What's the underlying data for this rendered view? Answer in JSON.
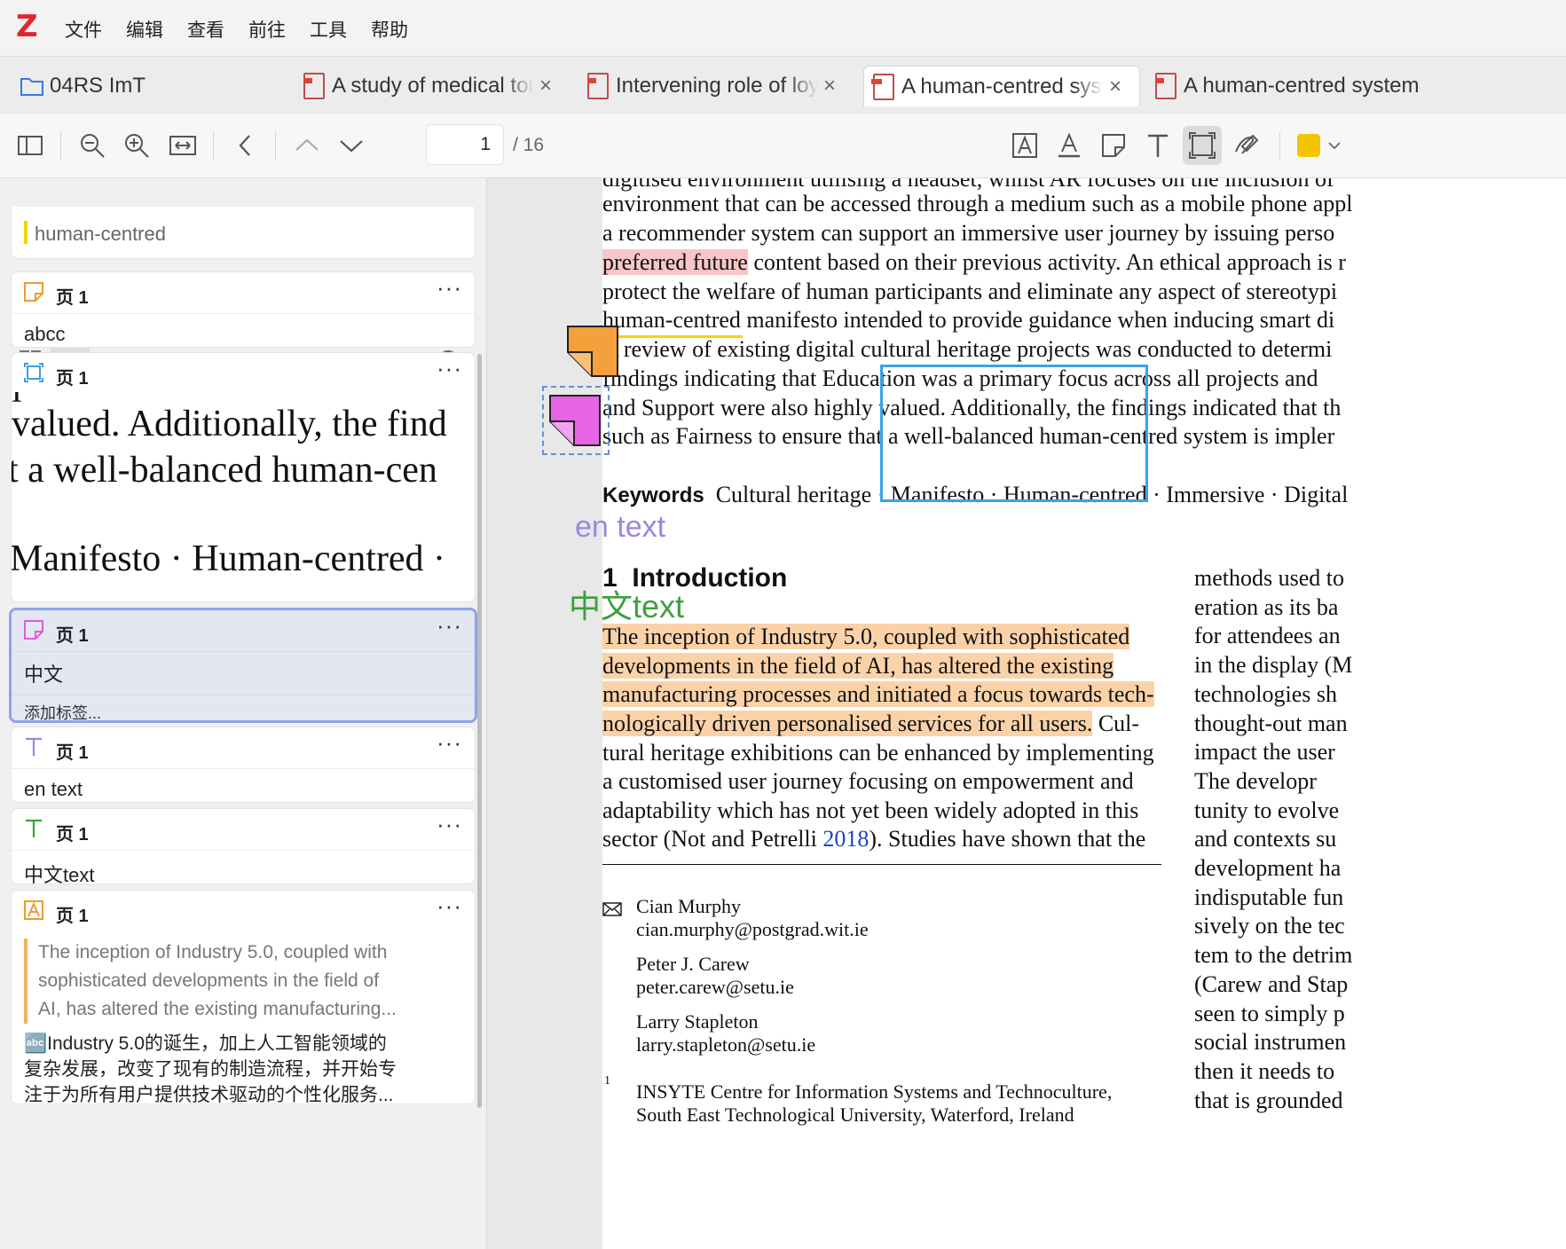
{
  "menu": [
    "文件",
    "编辑",
    "查看",
    "前往",
    "工具",
    "帮助"
  ],
  "tabs": {
    "library": "04RS ImT",
    "docs": [
      {
        "title": "A study of medical tourism",
        "active": false
      },
      {
        "title": "Intervening role of loyalty",
        "active": false
      },
      {
        "title": "A human-centred system",
        "active": true
      },
      {
        "title": "A human-centred system",
        "active": false
      }
    ]
  },
  "toolbar": {
    "page_current": "1",
    "page_total": "/ 16",
    "highlight_color": "#f5c400"
  },
  "sidebar": {
    "top_partial_text": "human-centred",
    "cards": [
      {
        "type": "note",
        "page": "页 1",
        "body": "abcc"
      },
      {
        "type": "image",
        "page": "页 1",
        "snippet_lines": [
          "valued. Additionally, the find",
          "t a well-balanced human-cen",
          "Manifesto · Human-centred ·"
        ]
      },
      {
        "type": "note",
        "page": "页 1",
        "body": "中文",
        "tags_placeholder": "添加标签..."
      },
      {
        "type": "text",
        "page": "页 1",
        "body": "en text"
      },
      {
        "type": "text",
        "page": "页 1",
        "body": "中文text"
      },
      {
        "type": "highlight",
        "page": "页 1",
        "quote": [
          "The inception of Industry 5.0, coupled with",
          "sophisticated developments in the field of",
          "AI, has altered the existing manufacturing..."
        ],
        "translation": [
          "🔤Industry 5.0的诞生，加上人工智能领域的",
          "复杂发展，改变了现有的制造流程，并开始专",
          "注于为所有用户提供技术驱动的个性化服务..."
        ]
      }
    ],
    "more": "···"
  },
  "document": {
    "lines_top": [
      "environment that can be accessed through a medium such as a mobile phone appl",
      "a recommender system can support an immersive user journey by issuing perso",
      "content based on their previous activity. An ethical approach is r",
      "protect the welfare of human participants and eliminate any aspect of stereotypi",
      "human-centred manifesto intended to provide guidance when inducing smart di",
      "A review of existing digital cultural heritage projects was conducted to determi",
      "findings indicating that Education was a primary focus across all projects and",
      "and Support were also highly valued. Additionally, the findings indicated that th",
      "such as Fairness to ensure that a well-balanced human-centred system is impler"
    ],
    "preferred_future": "preferred future",
    "keywords_label": "Keywords",
    "keywords": "Cultural heritage · Manifesto · Human-centred · Immersive · Digital",
    "en_text": "en text",
    "zh_text": "中文text",
    "section_number": "1",
    "section_title": "Introduction",
    "intro_highlight": [
      "The inception of Industry 5.0, coupled with sophisticated",
      "developments in the field of AI, has altered the existing",
      "manufacturing processes and initiated a focus towards tech-",
      "nologically driven personalised services for all users."
    ],
    "intro_cont": " Cul-",
    "intro_rest": [
      "tural heritage exhibitions can be enhanced by implementing",
      "a customised user journey focusing on empowerment and",
      "adaptability which has not yet been widely adopted in this"
    ],
    "intro_last_pre": "sector (Not and Petrelli ",
    "intro_last_link": "2018",
    "intro_last_post": "). Studies have shown that the",
    "authors": [
      {
        "name": "Cian Murphy",
        "email": "cian.murphy@postgrad.wit.ie"
      },
      {
        "name": "Peter J. Carew",
        "email": "peter.carew@setu.ie"
      },
      {
        "name": "Larry Stapleton",
        "email": "larry.stapleton@setu.ie"
      }
    ],
    "affil_num": "1",
    "affiliation": [
      "INSYTE Centre for Information Systems and Technoculture,",
      "South East Technological University, Waterford, Ireland"
    ],
    "right_col": [
      "methods used to",
      "eration as its ba",
      "for attendees an",
      "in the display (M",
      "technologies sh",
      "thought-out man",
      "impact the user",
      "   The developr",
      "tunity to evolve",
      "and contexts su",
      "development ha",
      "indisputable fun",
      "sively on the tec",
      "tem to the detrim",
      "(Carew and Stap",
      "seen to simply p",
      "social instrumen",
      "then it needs to",
      "that is grounded"
    ]
  }
}
